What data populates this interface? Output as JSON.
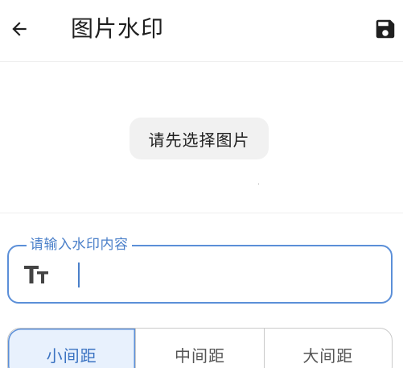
{
  "app_bar": {
    "title": "图片水印",
    "back_icon": "arrow-left-icon",
    "save_icon": "floppy-disk-icon"
  },
  "preview": {
    "select_button_label": "请先选择图片"
  },
  "watermark_field": {
    "label": "请输入水印内容",
    "value": "",
    "icon": "text-size-icon"
  },
  "spacing": {
    "options": [
      "小间距",
      "中间距",
      "大间距"
    ],
    "selected_index": 0
  },
  "colors": {
    "accent": "#5b8fd8",
    "accent_text": "#3b73c2",
    "selected_bg": "#e8f1fd",
    "button_bg": "#f1f1f1"
  }
}
